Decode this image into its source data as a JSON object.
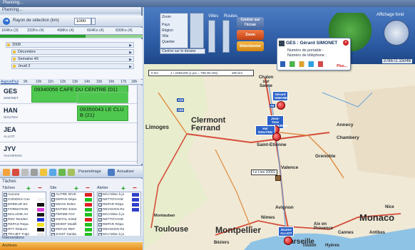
{
  "window": {
    "title": "Planning..."
  },
  "left": {
    "header": "Planning...",
    "radius_label": "Rayon de sélection (km)",
    "radius_value": "1000",
    "scale": [
      "164Kn (3)",
      "332Kn (4)",
      "498Kn (4)",
      "664Kn (4)",
      "830Kn (4)"
    ],
    "dates": [
      "2008",
      "Décembre",
      "Semaine 49",
      "Jeudi 3"
    ],
    "hours_label": "Aujourd'hui",
    "hours": [
      "9h",
      "10h",
      "11h",
      "12h",
      "13h",
      "14h",
      "15h",
      "16h",
      "17h",
      "18h"
    ],
    "technicians": [
      {
        "name": "GES",
        "sub": "SIMONET"
      },
      {
        "name": "HAN",
        "sub": "NGUYEN"
      },
      {
        "name": "JEA",
        "sub": "ALLIOT"
      },
      {
        "name": "JYV",
        "sub": "VACHERON"
      }
    ],
    "tasks": [
      {
        "text": "09340056 CAFE DU CENTRE (01)"
      },
      {
        "text": "09350043 LE CLU B (21)"
      }
    ],
    "toolbar": {
      "param": "Paramétrage",
      "refresh": "Actualiser"
    },
    "taches_header": "Tâches",
    "columns": {
      "taches": {
        "title": "Tâches",
        "items": [
          "Aucune",
          "CONGES Con",
          "ERREUR Err",
          "FORMATION",
          "MALADIE Arr",
          "RDV Rendez",
          "REPAS Repa",
          "RTT Réducti",
          "TRAJET Traje",
          "Aucune"
        ]
      },
      "site": {
        "title": "Site",
        "items": [
          "AUTRE DIVE",
          "DEPAN Dépa",
          "DEVIS Relev",
          "ENTMC Entre",
          "FERME Ferr",
          "INSTAL Instal",
          "MODIF Modifi",
          "REFUS REF.",
          "SANIT Sanita",
          "AUTRE DIVE"
        ]
      },
      "atelier": {
        "title": "Atelier",
        "items": [
          "MAJ Mise à jo",
          "NETTOYAGE",
          "REPAR Répa",
          "REVISION Re",
          "MAJ Mise à jo",
          "NETTOYAGE",
          "REPAR Répa",
          "REVISION Re",
          "MAJ Mise à jo",
          "NETTOYAGE"
        ]
      }
    },
    "interventions": "Interventions",
    "archives": "Archives"
  },
  "map": {
    "toolbar": {
      "zoom": "Zoom",
      "villes": "Villes",
      "routes": "Routes",
      "pays": "Pays",
      "region": "Région",
      "ville": "Ville",
      "quartier": "Quartier",
      "centrer": "Centrer sur le dossier",
      "btn_center": "Centrer sur l'écran",
      "btn_zoom": "Zoom",
      "btn_select": "Sélectionner",
      "affichage": "Affichage fond",
      "coord": "378672.15046"
    },
    "scale_labels": [
      "0 km",
      "1 / 2294159 (1 pix = 796.00 mts)",
      "200 km"
    ],
    "cities": [
      "Chalon sur Saône",
      "Clermont Ferrand",
      "Limoges",
      "Saint-Etienne",
      "Grenoble",
      "Annecy",
      "Chambery",
      "Valence",
      "Montpellier",
      "Toulouse",
      "Marseille",
      "Nimes",
      "Avignon",
      "Monaco",
      "Cannes",
      "Nice",
      "Aix en Provence",
      "Béziers",
      "Montauban",
      "Toulon",
      "Hyères",
      "Antibes"
    ],
    "pins": [
      "Gérard SIMONET",
      "Jean-Yves VACHERON",
      "Hai NGUYEN",
      "Jeanne ALLIOT"
    ],
    "popup": {
      "title": "GES : Gérard SIMONET",
      "line1": "Numéro de portable :",
      "line2": "Numéro de téléphone :",
      "more": "Plus..."
    },
    "task_marker": "Le Lios 10001"
  }
}
